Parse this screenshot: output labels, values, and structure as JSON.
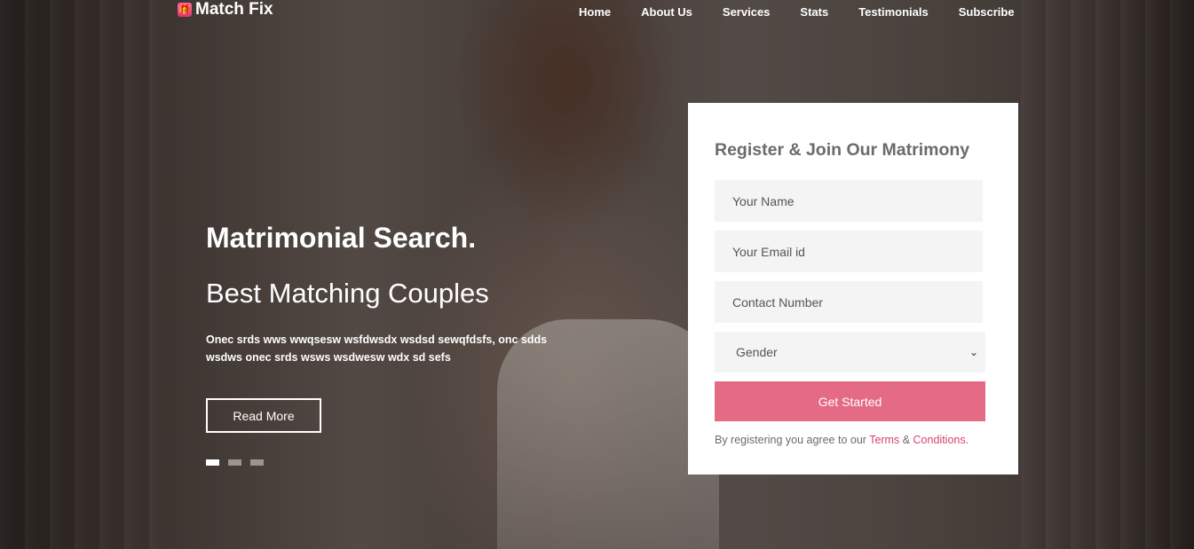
{
  "brand": {
    "name": "Match Fix",
    "icon": "gift-icon"
  },
  "nav": [
    "Home",
    "About Us",
    "Services",
    "Stats",
    "Testimonials",
    "Subscribe"
  ],
  "hero": {
    "title": "Matrimonial Search.",
    "subtitle": "Best Matching Couples",
    "description": "Onec srds wws wwqsesw wsfdwsdx wsdsd sewqfdsfs, onc sdds wsdws onec srds wsws wsdwesw wdx sd sefs",
    "button": "Read More",
    "slides": 3,
    "active_slide": 1
  },
  "form": {
    "title": "Register & Join Our Matrimony",
    "name_placeholder": "Your Name",
    "email_placeholder": "Your Email id",
    "phone_placeholder": "Contact Number",
    "gender_label": "Gender",
    "submit": "Get Started",
    "terms_prefix": "By registering you agree to our",
    "terms_link": "Terms",
    "terms_amp": "&",
    "conditions_link": "Conditions."
  },
  "colors": {
    "accent": "#e46a85",
    "link": "#d6456a"
  }
}
